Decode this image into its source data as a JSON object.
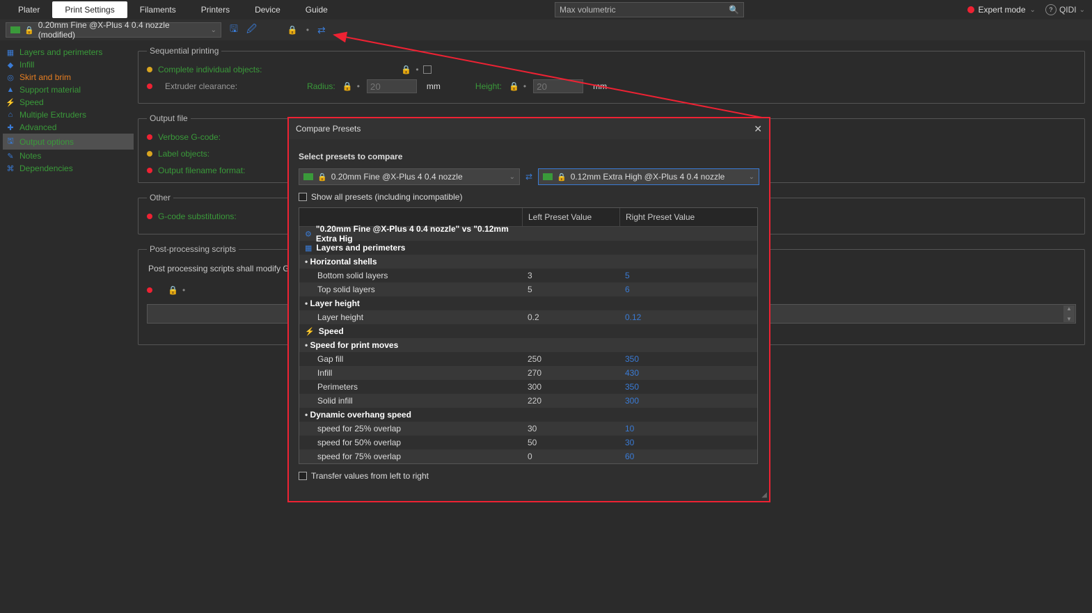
{
  "top_tabs": {
    "plater": "Plater",
    "print_settings": "Print Settings",
    "filaments": "Filaments",
    "printers": "Printers",
    "device": "Device",
    "guide": "Guide"
  },
  "search": {
    "value": "Max volumetric"
  },
  "mode": {
    "label": "Expert mode"
  },
  "brand": {
    "name": "QIDI",
    "badge": "?"
  },
  "preset": {
    "name": "0.20mm Fine @X-Plus 4 0.4 nozzle (modified)"
  },
  "sidebar": [
    {
      "label": "Layers and perimeters",
      "icon": "▦"
    },
    {
      "label": "Infill",
      "icon": "◆"
    },
    {
      "label": "Skirt and brim",
      "icon": "◎",
      "orange": true
    },
    {
      "label": "Support material",
      "icon": "▲"
    },
    {
      "label": "Speed",
      "icon": "⚡"
    },
    {
      "label": "Multiple Extruders",
      "icon": "⌂"
    },
    {
      "label": "Advanced",
      "icon": "✚"
    },
    {
      "label": "Output options",
      "icon": "🖫",
      "selected": true
    },
    {
      "label": "Notes",
      "icon": "✎"
    },
    {
      "label": "Dependencies",
      "icon": "⌘"
    }
  ],
  "seq": {
    "legend": "Sequential printing",
    "complete": "Complete individual objects:",
    "extruder": "Extruder clearance:",
    "radius": "Radius:",
    "height": "Height:",
    "radius_val": "20",
    "height_val": "20",
    "unit": "mm"
  },
  "output": {
    "legend": "Output file",
    "verbose": "Verbose G-code:",
    "label_obj": "Label objects:",
    "fname_fmt": "Output filename format:"
  },
  "other": {
    "legend": "Other",
    "subst": "G-code substitutions:"
  },
  "pp": {
    "legend": "Post-processing scripts",
    "desc": "Post processing scripts shall modify G-"
  },
  "modal": {
    "title": "Compare Presets",
    "select_label": "Select presets to compare",
    "left_preset": "0.20mm Fine @X-Plus 4 0.4 nozzle",
    "right_preset": "0.12mm Extra High @X-Plus 4 0.4 nozzle",
    "show_all": "Show all presets (including incompatible)",
    "col_left": "Left Preset Value",
    "col_right": "Right Preset Value",
    "vs_title": "\"0.20mm Fine @X-Plus 4 0.4 nozzle\" vs \"0.12mm Extra Hig",
    "cat_layers": "Layers and perimeters",
    "hshells": "Horizontal shells",
    "bottom_solid": "Bottom solid layers",
    "top_solid": "Top solid layers",
    "layer_h_grp": "Layer height",
    "layer_h": "Layer height",
    "cat_speed": "Speed",
    "speed_moves": "Speed for print moves",
    "gap_fill": "Gap fill",
    "infill": "Infill",
    "perimeters": "Perimeters",
    "solid_infill": "Solid infill",
    "dyn_over": "Dynamic overhang speed",
    "sp25": "speed for 25% overlap",
    "sp50": "speed for 50% overlap",
    "sp75": "speed for 75% overlap",
    "transfer": "Transfer values from left to right",
    "vals": {
      "bottom_solid": [
        "3",
        "5"
      ],
      "top_solid": [
        "5",
        "6"
      ],
      "layer_h": [
        "0.2",
        "0.12"
      ],
      "gap_fill": [
        "250",
        "350"
      ],
      "infill": [
        "270",
        "430"
      ],
      "perimeters": [
        "300",
        "350"
      ],
      "solid_infill": [
        "220",
        "300"
      ],
      "sp25": [
        "30",
        "10"
      ],
      "sp50": [
        "50",
        "30"
      ],
      "sp75": [
        "0",
        "60"
      ]
    }
  }
}
